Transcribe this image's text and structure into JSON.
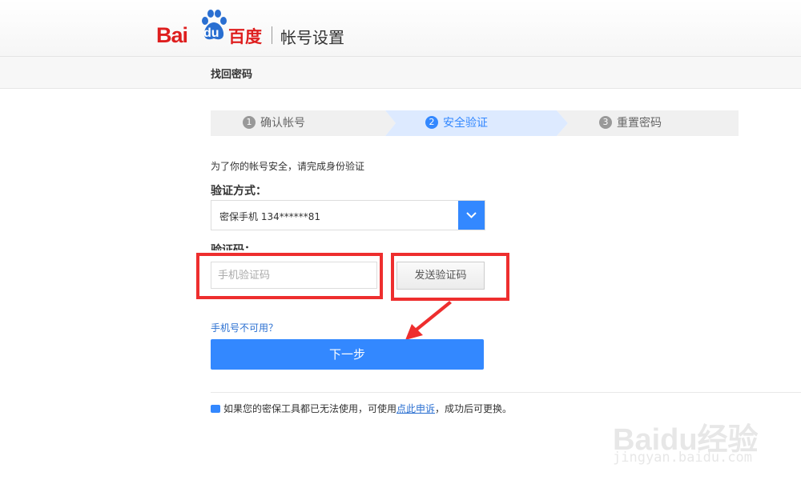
{
  "header": {
    "logo_bai": "Bai",
    "logo_du": "du",
    "logo_cn": "百度",
    "title": "帐号设置"
  },
  "subbar": {
    "title": "找回密码"
  },
  "steps": [
    {
      "num": "1",
      "label": "确认帐号",
      "state": "done"
    },
    {
      "num": "2",
      "label": "安全验证",
      "state": "active"
    },
    {
      "num": "3",
      "label": "重置密码",
      "state": "pending"
    }
  ],
  "form": {
    "tip": "为了你的帐号安全，请完成身份验证",
    "method_label": "验证方式：",
    "method_value": "密保手机 134******81",
    "code_label": "验证码：",
    "code_placeholder": "手机验证码",
    "send_label": "发送验证码",
    "unavailable_link": "手机号不可用？",
    "next_label": "下一步"
  },
  "bottom_tip": {
    "before": "如果您的密保工具都已无法使用，可使用",
    "link": "点此申诉",
    "after": "，成功后可更换。"
  },
  "watermark": {
    "text": "Baidu经验",
    "sub": "jingyan.baidu.com"
  },
  "colors": {
    "brand_red": "#de1e1e",
    "accent_blue": "#3388ff",
    "annotation_red": "#ee2e2e"
  }
}
